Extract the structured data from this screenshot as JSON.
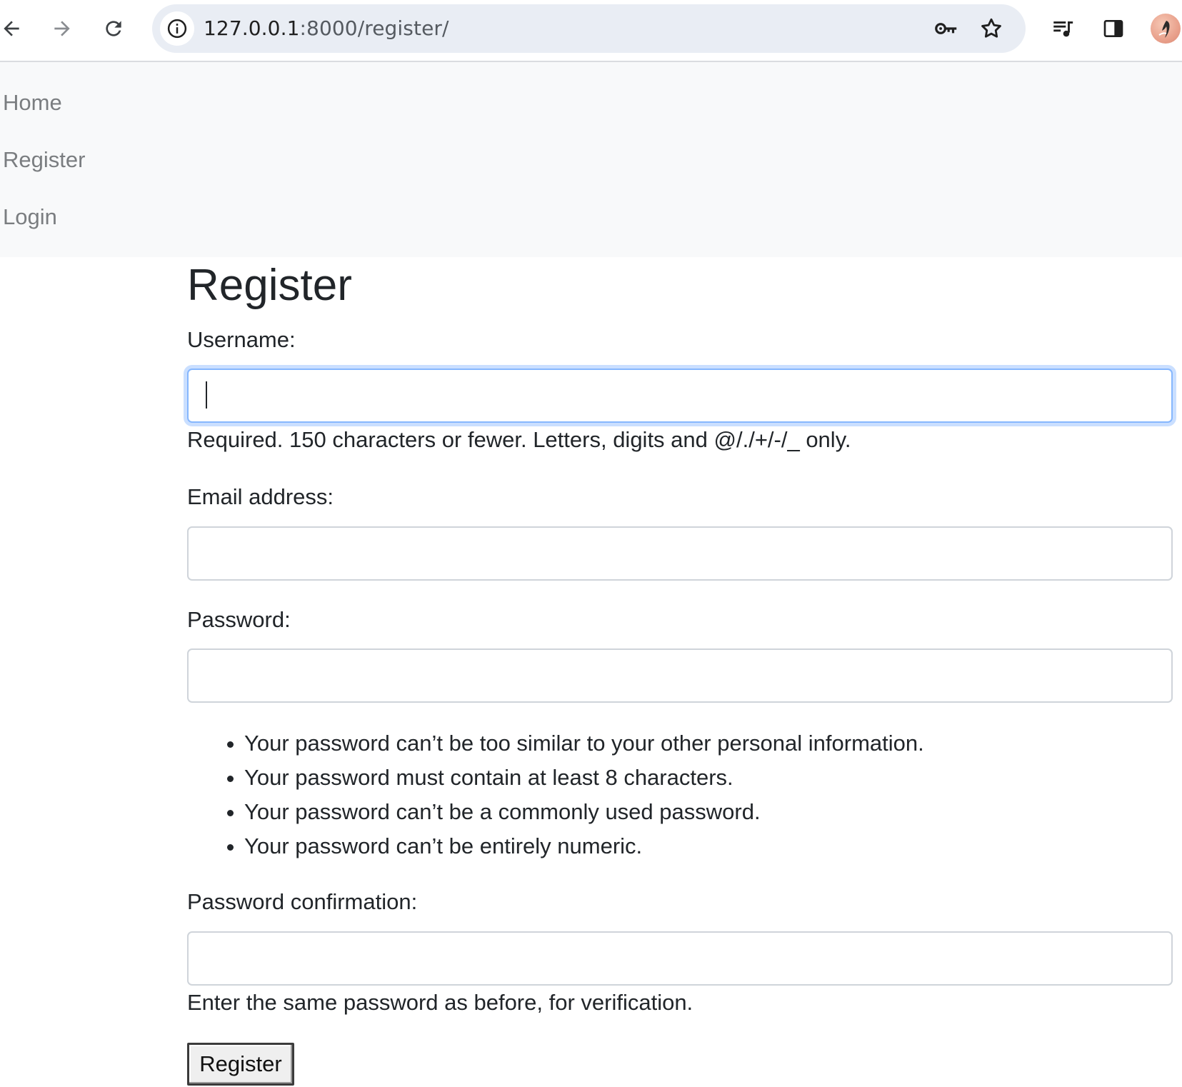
{
  "browser": {
    "url_host": "127.0.0.1",
    "url_rest": ":8000/register/",
    "icons": {
      "back": "arrow-left-icon",
      "forward": "arrow-right-icon",
      "reload": "reload-icon",
      "site_info": "info-icon",
      "password": "key-icon",
      "bookmark": "star-icon",
      "media": "media-playlist-icon",
      "side_panel": "side-panel-icon",
      "profile": "profile-avatar"
    }
  },
  "nav": {
    "items": [
      {
        "label": "Home"
      },
      {
        "label": "Register"
      },
      {
        "label": "Login"
      }
    ]
  },
  "form": {
    "title": "Register",
    "username": {
      "label": "Username:",
      "value": "",
      "help": "Required. 150 characters or fewer. Letters, digits and @/./+/-/_ only."
    },
    "email": {
      "label": "Email address:",
      "value": ""
    },
    "password": {
      "label": "Password:",
      "value": "",
      "rules": [
        "Your password can’t be too similar to your other personal information.",
        "Your password must contain at least 8 characters.",
        "Your password can’t be a commonly used password.",
        "Your password can’t be entirely numeric."
      ]
    },
    "password_confirmation": {
      "label": "Password confirmation:",
      "value": "",
      "help": "Enter the same password as before, for verification."
    },
    "submit_label": "Register"
  },
  "colors": {
    "navbar_bg": "#f8f9fa",
    "nav_link": "#7a7d80",
    "focus_ring": "#86b7fe",
    "omnibox_bg": "#e9edf4"
  }
}
